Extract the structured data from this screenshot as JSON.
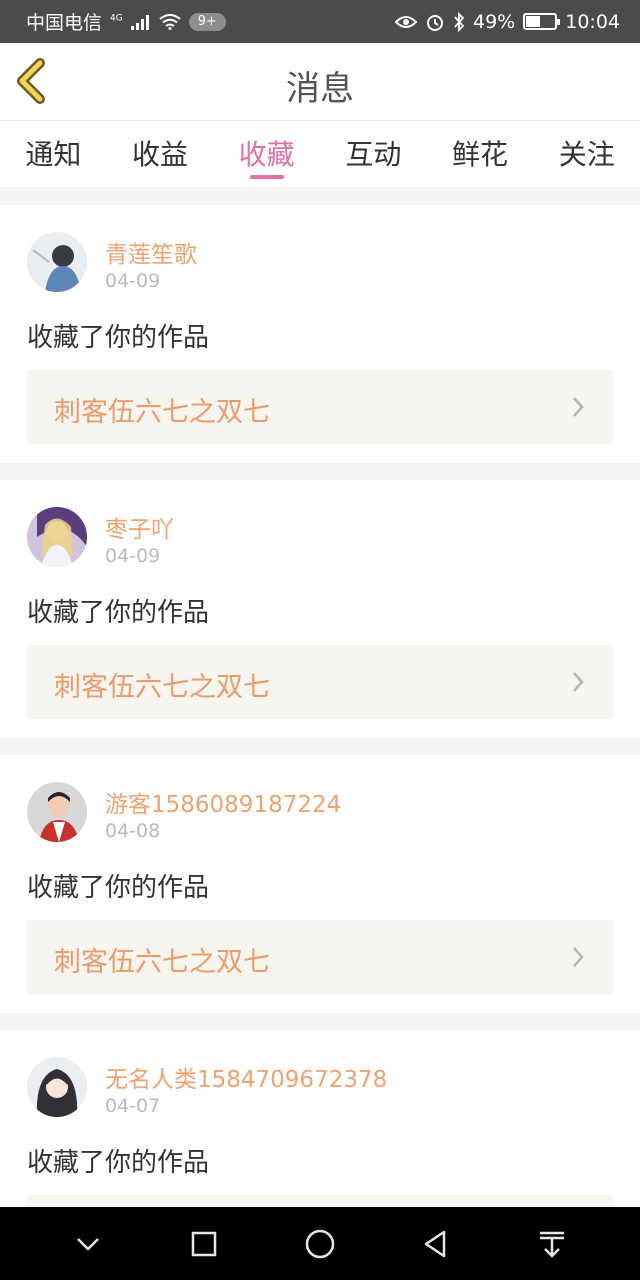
{
  "status_bar": {
    "carrier": "中国电信",
    "network": "4G",
    "notification_badge": "9+",
    "battery": "49%",
    "battery_level": 0.49,
    "time": "10:04"
  },
  "header": {
    "title": "消息"
  },
  "tabs": [
    {
      "label": "通知",
      "active": false
    },
    {
      "label": "收益",
      "active": false
    },
    {
      "label": "收藏",
      "active": true
    },
    {
      "label": "互动",
      "active": false
    },
    {
      "label": "鲜花",
      "active": false
    },
    {
      "label": "关注",
      "active": false
    }
  ],
  "messages": [
    {
      "username": "青莲笙歌",
      "date": "04-09",
      "action": "收藏了你的作品",
      "work_title": "刺客伍六七之双七"
    },
    {
      "username": "枣子吖",
      "date": "04-09",
      "action": "收藏了你的作品",
      "work_title": "刺客伍六七之双七"
    },
    {
      "username": "游客1586089187224",
      "date": "04-08",
      "action": "收藏了你的作品",
      "work_title": "刺客伍六七之双七"
    },
    {
      "username": "无名人类1584709672378",
      "date": "04-07",
      "action": "收藏了你的作品",
      "work_title": ""
    }
  ],
  "colors": {
    "accent_tab": "#e36fa5",
    "username": "#f0a26f",
    "work_title": "#ee9b6b",
    "work_box": "#f6f5ef"
  },
  "icons": [
    "back-icon",
    "chevron-right-icon",
    "nav-back-icon",
    "nav-home-icon",
    "nav-recent-icon",
    "nav-down-icon",
    "nav-notification-icon"
  ]
}
